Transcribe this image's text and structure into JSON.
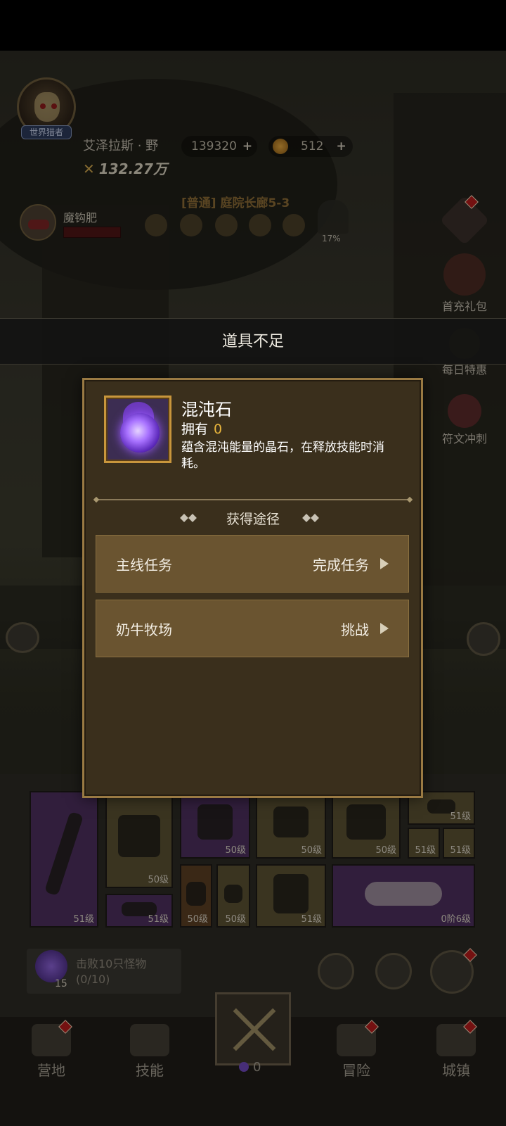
{
  "hud": {
    "player_name": "艾泽拉斯",
    "player_suffix": "野",
    "player_tag": "世界猎者",
    "power": "132.27万",
    "gems": "139320",
    "coins": "512",
    "boss_name": "魔钩肥",
    "stage": "[普通] 庭院长廊5-3",
    "stage_progress": "17%"
  },
  "side_menu": {
    "first_recharge": "首充礼包",
    "daily_deal": "每日特惠",
    "rune_sprint": "符文冲刺"
  },
  "toast": "道具不足",
  "dialog": {
    "item_name": "混沌石",
    "owned_label": "拥有",
    "owned_count": "0",
    "description": "蕴含混沌能量的晶石，在释放技能时消耗。",
    "section_title": "获得途径",
    "routes": [
      {
        "label": "主线任务",
        "action": "完成任务"
      },
      {
        "label": "奶牛牧场",
        "action": "挑战"
      }
    ]
  },
  "equipment": {
    "levels": [
      "51级",
      "50级",
      "50级",
      "50级",
      "50级",
      "51级",
      "51级",
      "51级",
      "51级",
      "50级",
      "50级",
      "51级",
      "0阶6级"
    ]
  },
  "quest": {
    "text": "击败10只怪物",
    "progress": "(0/10)",
    "count": "15"
  },
  "bottom_nav": {
    "camp": "营地",
    "skills": "技能",
    "battle_count": "0",
    "adventure": "冒险",
    "town": "城镇"
  }
}
